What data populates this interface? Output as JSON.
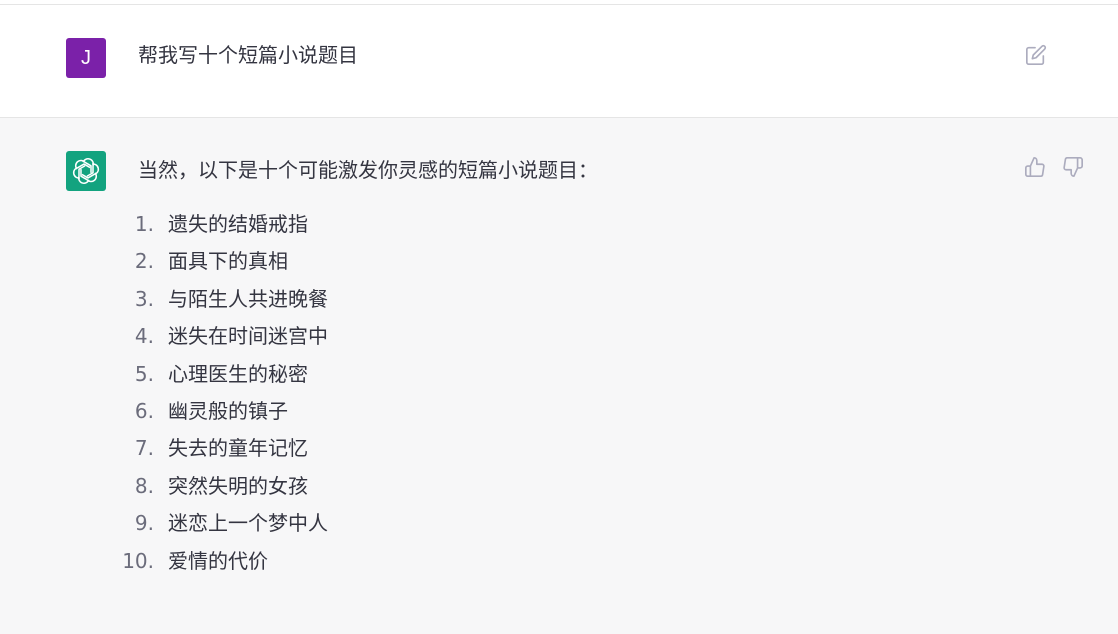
{
  "colors": {
    "user_avatar_bg": "#7b21a9",
    "assistant_avatar_bg": "#13a37f",
    "icon_gray": "#acacbe",
    "text": "#343541",
    "list_number": "#6b6c7b"
  },
  "user_message": {
    "avatar_letter": "J",
    "text": "帮我写十个短篇小说题目",
    "edit_icon": "edit-icon"
  },
  "assistant_message": {
    "avatar_icon": "openai-logo-icon",
    "intro": "当然，以下是十个可能激发你灵感的短篇小说题目：",
    "items": [
      {
        "number": "1.",
        "text": "遗失的结婚戒指"
      },
      {
        "number": "2.",
        "text": "面具下的真相"
      },
      {
        "number": "3.",
        "text": "与陌生人共进晚餐"
      },
      {
        "number": "4.",
        "text": "迷失在时间迷宫中"
      },
      {
        "number": "5.",
        "text": "心理医生的秘密"
      },
      {
        "number": "6.",
        "text": "幽灵般的镇子"
      },
      {
        "number": "7.",
        "text": "失去的童年记忆"
      },
      {
        "number": "8.",
        "text": "突然失明的女孩"
      },
      {
        "number": "9.",
        "text": "迷恋上一个梦中人"
      },
      {
        "number": "10.",
        "text": "爱情的代价"
      }
    ],
    "feedback_icons": [
      "thumbs-up-icon",
      "thumbs-down-icon"
    ]
  }
}
